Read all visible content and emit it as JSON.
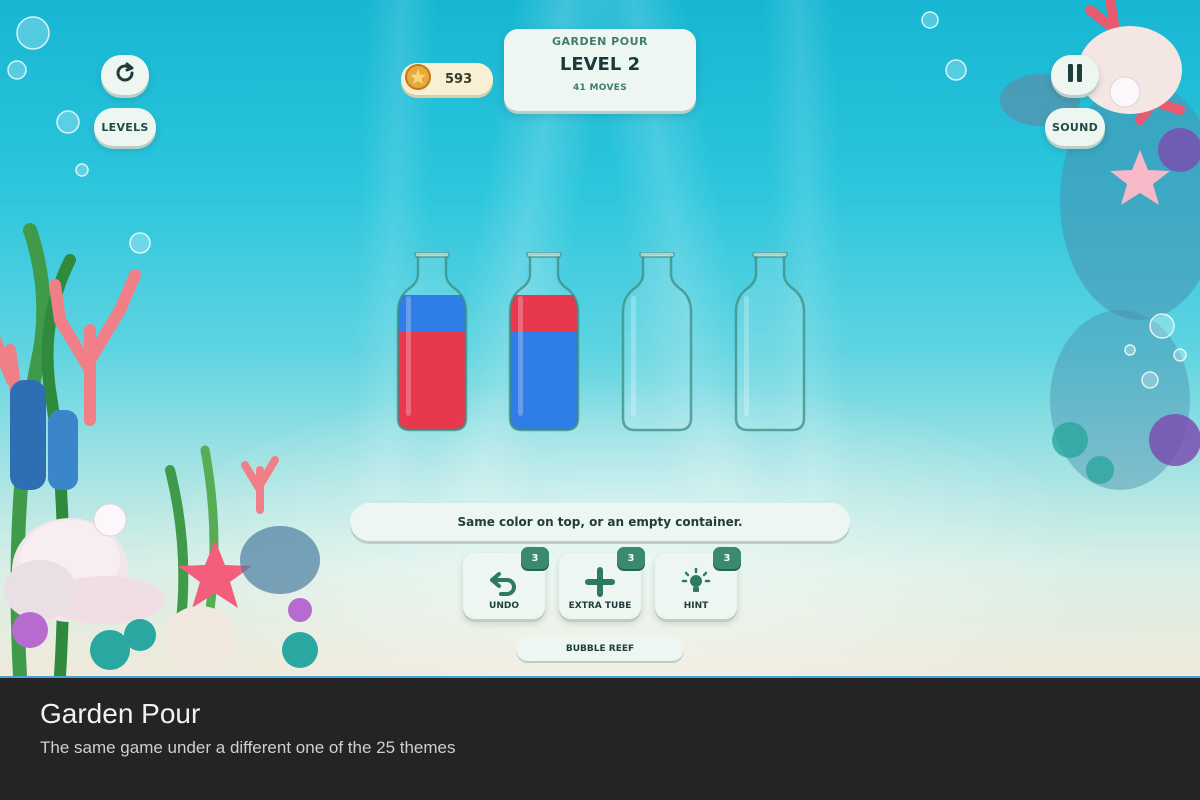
{
  "game": {
    "name": "GARDEN POUR",
    "level": "LEVEL 2",
    "moves": "41 MOVES",
    "coins": "593"
  },
  "controls": {
    "restart_icon": "restart-icon",
    "levels_label": "LEVELS",
    "pause_icon": "pause-icon",
    "sound_label": "SOUND"
  },
  "tubes": [
    {
      "layers": [
        "#e8384e",
        "#2f7de6"
      ]
    },
    {
      "layers": [
        "#2f7de6",
        "#e8384e"
      ]
    },
    {
      "layers": []
    },
    {
      "layers": []
    }
  ],
  "colors": {
    "red": "#e8384e",
    "blue": "#2f7de6",
    "accent": "#3a8a6f"
  },
  "hint_text": "Same color on top, or an empty container.",
  "tools": [
    {
      "label": "UNDO",
      "count": "3",
      "icon": "undo-icon"
    },
    {
      "label": "EXTRA TUBE",
      "count": "3",
      "icon": "plus-icon"
    },
    {
      "label": "HINT",
      "count": "3",
      "icon": "lightbulb-icon"
    }
  ],
  "theme_label": "BUBBLE REEF",
  "caption": {
    "title": "Garden Pour",
    "subtitle": "The same game under a different one of the 25 themes"
  }
}
